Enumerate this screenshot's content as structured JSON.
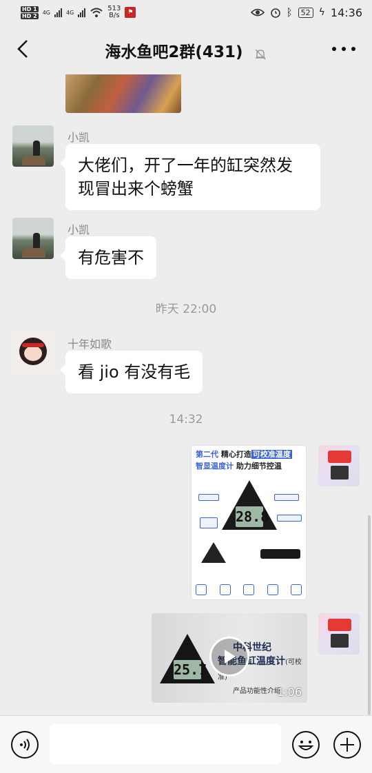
{
  "status_bar": {
    "hd1": "HD 1",
    "hd2": "HD 2",
    "net1": "4G",
    "net2": "4G",
    "speed_value": "513",
    "speed_unit": "B/s",
    "battery": "52",
    "time": "14:36"
  },
  "header": {
    "title": "海水鱼吧2群(431)",
    "back_icon": "back-arrow-icon",
    "mute_icon": "bell-off-icon",
    "more_icon": "more-dots-icon"
  },
  "messages": [
    {
      "sender": "小凯",
      "text": "大佬们，开了一年的缸突然发现冒出来个螃蟹"
    },
    {
      "sender": "小凯",
      "text": "有危害不"
    },
    {
      "sender": "十年如歌",
      "text": "看 jio 有没有毛"
    }
  ],
  "timestamps": [
    "昨天 22:00",
    "14:32"
  ],
  "image_card": {
    "line1_a": "第二代",
    "line1_b": "精心打造",
    "line1_c": "可校准温度",
    "line2_a": "智显温度计",
    "line2_b": "助力细节控温",
    "lcd": "28.8"
  },
  "video_card": {
    "brand": "中科世纪",
    "product": "智能鱼缸温度计",
    "note": "(可校准)",
    "subtitle": "产品功能性介绍",
    "lcd": "25.7",
    "duration": "1:06"
  },
  "input_bar": {
    "placeholder": "",
    "voice_icon": "voice-icon",
    "emoji_icon": "emoji-icon",
    "plus_icon": "plus-icon"
  }
}
